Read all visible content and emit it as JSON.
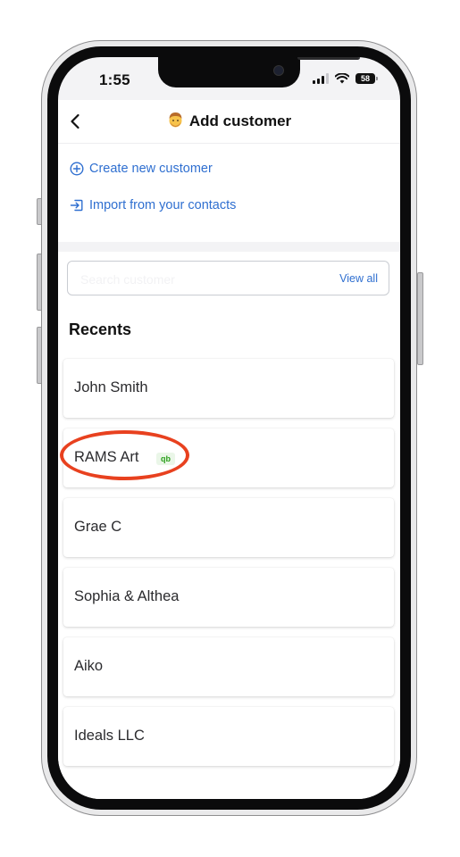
{
  "status_bar": {
    "time": "1:55",
    "battery": "58"
  },
  "header": {
    "back_icon": "chevron-left-icon",
    "title_emoji": "person-emoji-icon",
    "title": "Add customer"
  },
  "actions": [
    {
      "icon": "plus-circle-icon",
      "label": "Create new customer"
    },
    {
      "icon": "import-icon",
      "label": "Import from your contacts"
    }
  ],
  "search": {
    "placeholder": "Search customer",
    "view_all": "View all"
  },
  "recents": {
    "title": "Recents",
    "customers": [
      {
        "name": "John Smith",
        "badge": ""
      },
      {
        "name": "RAMS Art",
        "badge": "qb"
      },
      {
        "name": "Grae C",
        "badge": ""
      },
      {
        "name": "Sophia & Althea",
        "badge": ""
      },
      {
        "name": "Aiko",
        "badge": ""
      },
      {
        "name": "Ideals LLC",
        "badge": ""
      }
    ]
  },
  "colors": {
    "link_blue": "#2f6fd0",
    "highlight_red": "#e8411f",
    "qb_green": "#2ca01c"
  }
}
